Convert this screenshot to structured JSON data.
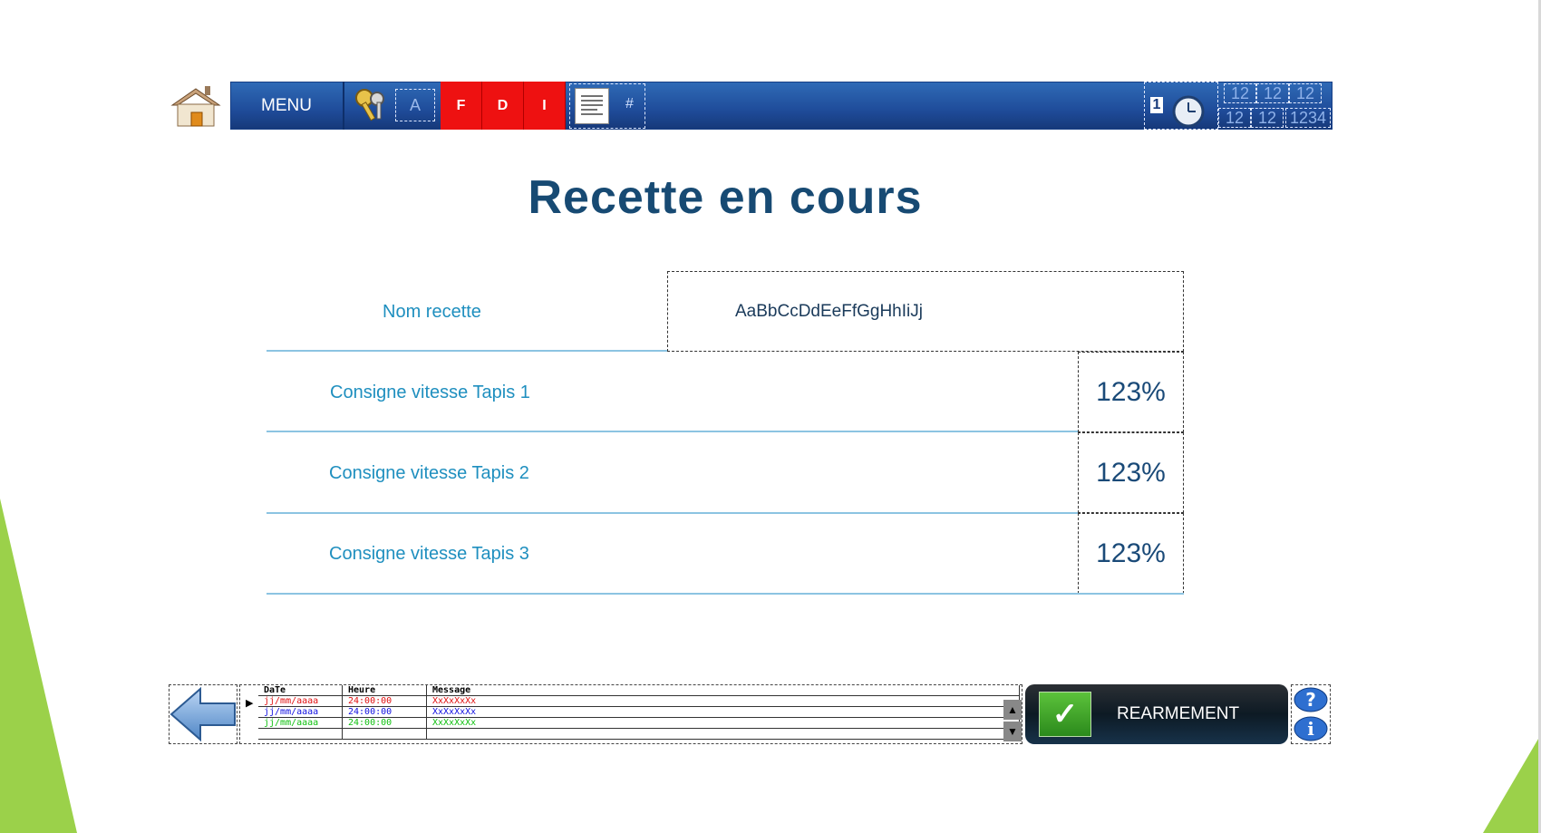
{
  "toolbar": {
    "menu_label": "MENU",
    "access_label": "A",
    "f_label": "F",
    "d_label": "D",
    "i_label": "I",
    "hash_label": "#",
    "clock_day": "1",
    "date_top": [
      "12",
      "12",
      "12"
    ],
    "date_bottom": [
      "12",
      "12",
      "1234"
    ]
  },
  "title": "Recette en cours",
  "recipe": {
    "name_label": "Nom recette",
    "name_value": "AaBbCcDdEeFfGgHhIiJj",
    "rows": [
      {
        "label": "Consigne vitesse Tapis 1",
        "value": "123%"
      },
      {
        "label": "Consigne vitesse Tapis 2",
        "value": "123%"
      },
      {
        "label": "Consigne vitesse Tapis 3",
        "value": "123%"
      }
    ]
  },
  "alarms": {
    "columns": [
      "DaTe",
      "Heure",
      "Message"
    ],
    "rows": [
      {
        "date": "jj/mm/aaaa",
        "time": "24:00:00",
        "msg": "XxXxXxXx",
        "color": "#e01010"
      },
      {
        "date": "jj/mm/aaaa",
        "time": "24:00:00",
        "msg": "XxXxXxXx",
        "color": "#1010e0"
      },
      {
        "date": "jj/mm/aaaa",
        "time": "24:00:00",
        "msg": "XxXxXxXx",
        "color": "#10c010"
      }
    ]
  },
  "rearm_label": "REARMEMENT",
  "colors": {
    "accent": "#1f4c9a",
    "alarm_red": "#ee1111",
    "label_blue": "#1f8fbf",
    "slide_green": "#9bd14a"
  }
}
